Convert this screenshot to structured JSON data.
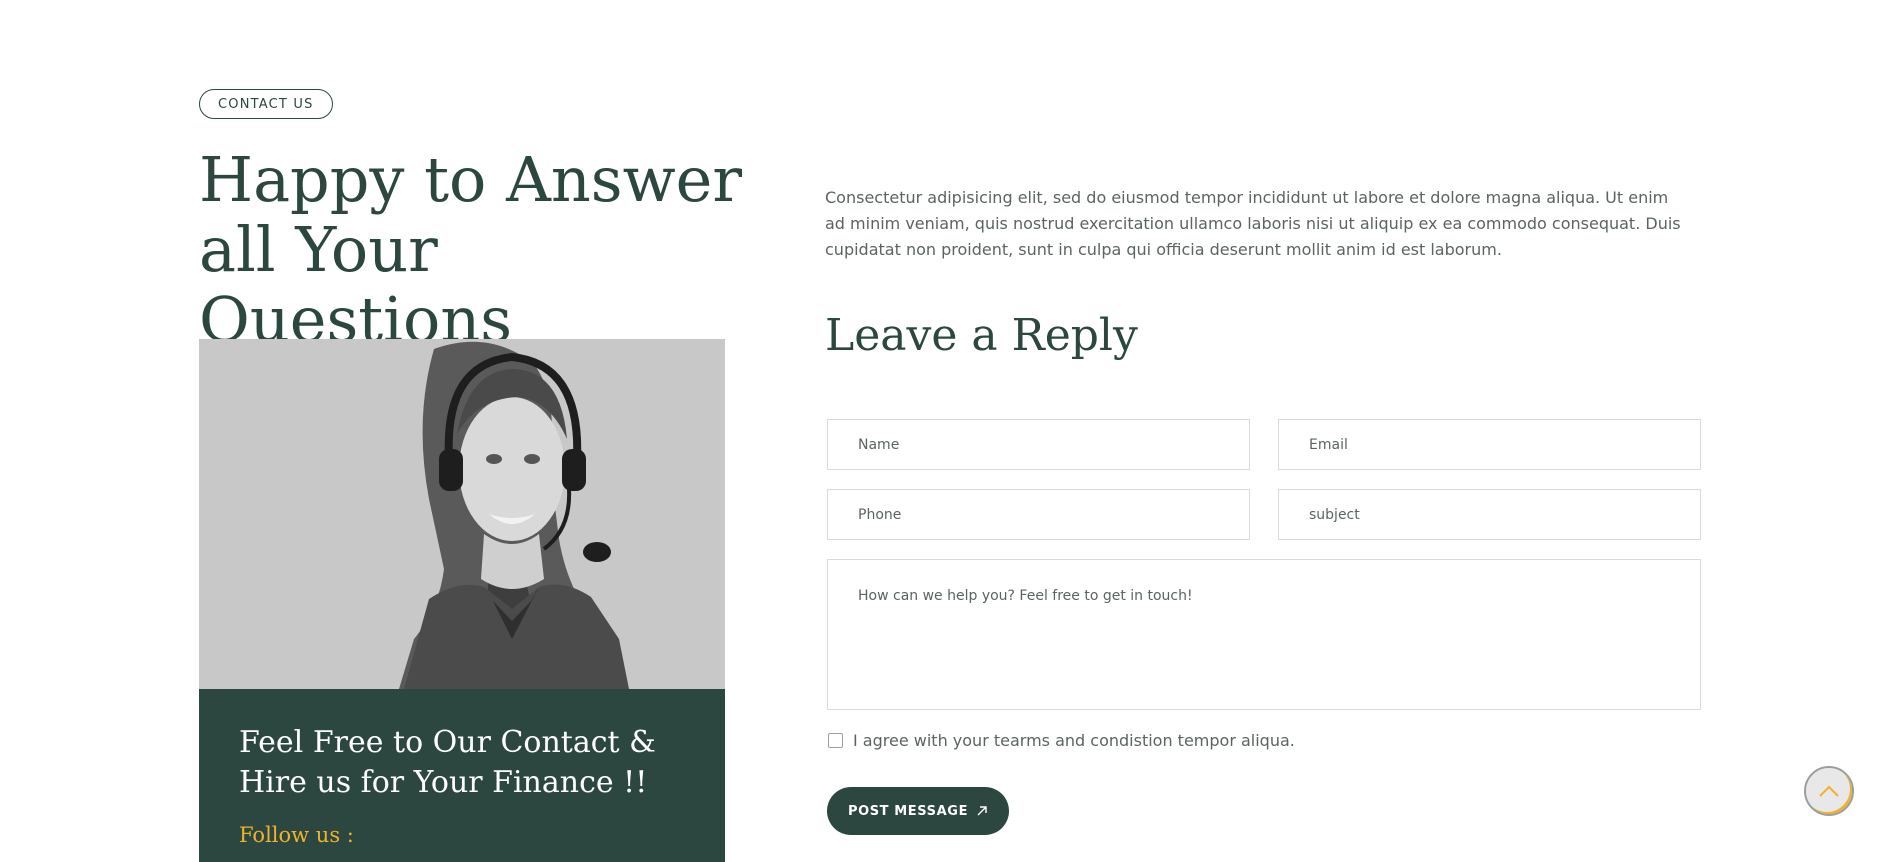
{
  "section": {
    "badge": "CONTACT US",
    "title": "Happy to Answer all Your Questions"
  },
  "info_box": {
    "title": "Feel Free to Our Contact & Hire us for Your Finance !!",
    "follow_label": "Follow us :"
  },
  "intro_text": "Consectetur adipisicing elit, sed do eiusmod tempor incididunt ut labore et dolore magna aliqua. Ut enim ad minim veniam, quis nostrud exercitation ullamco laboris nisi ut aliquip ex ea commodo consequat. Duis cupidatat non proident, sunt in culpa qui officia deserunt mollit anim id est laborum.",
  "form": {
    "title": "Leave a Reply",
    "name_placeholder": "Name",
    "email_placeholder": "Email",
    "phone_placeholder": "Phone",
    "subject_placeholder": "subject",
    "message_placeholder": "How can we help you? Feel free to get in touch!",
    "agree_label": "I agree with your tearms and condistion tempor aliqua.",
    "submit_label": "POST MESSAGE",
    "submit_icon": "arrow-up-right-icon"
  },
  "scroll_top": {
    "icon": "chevron-up-icon"
  },
  "colors": {
    "primary": "#2b4740",
    "accent": "#f2b12c",
    "text_muted": "#5b6461",
    "border": "#d9dcdb"
  }
}
